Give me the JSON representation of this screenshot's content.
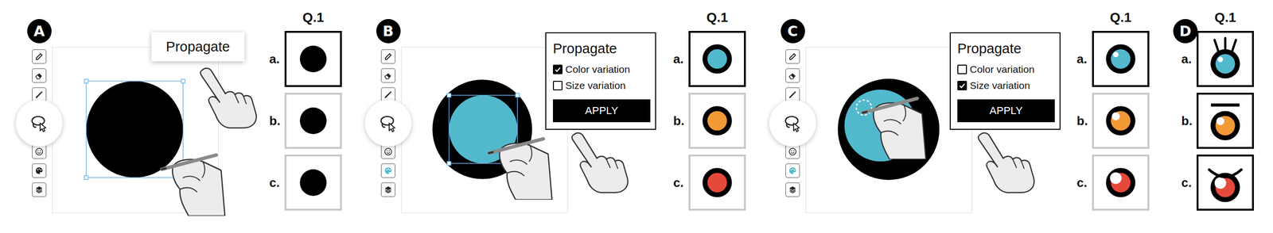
{
  "figure": {
    "panels": [
      {
        "badge": "A",
        "toolbar": [
          {
            "kind": "pencil",
            "selected": false
          },
          {
            "kind": "eraser",
            "selected": false
          },
          {
            "kind": "wand",
            "selected": false
          },
          {
            "kind": "smiley",
            "selected": false
          },
          {
            "kind": "palette",
            "selected": false
          },
          {
            "kind": "layers",
            "selected": false
          }
        ],
        "canvas": {
          "outer": "#000000",
          "inner": null,
          "selection": "outer",
          "draft": false
        },
        "menu": {
          "kind": "tooltip",
          "title": "Propagate",
          "options": [],
          "button": null
        },
        "question": {
          "title": "Q.1",
          "items": [
            {
              "label": "a.",
              "selected": true,
              "kind": "plain",
              "outer": "#000000",
              "pupil": null,
              "glint": "none"
            },
            {
              "label": "b.",
              "selected": false,
              "kind": "plain",
              "outer": "#000000",
              "pupil": null,
              "glint": "none"
            },
            {
              "label": "c.",
              "selected": false,
              "kind": "plain",
              "outer": "#000000",
              "pupil": null,
              "glint": "none"
            }
          ]
        }
      },
      {
        "badge": "B",
        "toolbar": [
          {
            "kind": "pencil",
            "selected": false
          },
          {
            "kind": "eraser",
            "selected": false
          },
          {
            "kind": "wand",
            "selected": false
          },
          {
            "kind": "smiley",
            "selected": false
          },
          {
            "kind": "palette",
            "selected": true
          },
          {
            "kind": "layers",
            "selected": false
          }
        ],
        "canvas": {
          "outer": "#000000",
          "inner": "#52b9cd",
          "selection": "inner",
          "draft": false
        },
        "menu": {
          "kind": "popup",
          "title": "Propagate",
          "options": [
            {
              "label": "Color variation",
              "checked": true
            },
            {
              "label": "Size variation",
              "checked": false
            }
          ],
          "button": "APPLY"
        },
        "question": {
          "title": "Q.1",
          "items": [
            {
              "label": "a.",
              "selected": true,
              "kind": "plain",
              "outer": "#000000",
              "pupil": "#52b9cd",
              "glint": "none"
            },
            {
              "label": "b.",
              "selected": false,
              "kind": "plain",
              "outer": "#000000",
              "pupil": "#f29a36",
              "glint": "none"
            },
            {
              "label": "c.",
              "selected": false,
              "kind": "plain",
              "outer": "#000000",
              "pupil": "#e5493a",
              "glint": "none"
            }
          ]
        }
      },
      {
        "badge": "C",
        "toolbar": [
          {
            "kind": "pencil",
            "selected": false
          },
          {
            "kind": "eraser",
            "selected": false
          },
          {
            "kind": "wand",
            "selected": false
          },
          {
            "kind": "smiley",
            "selected": false
          },
          {
            "kind": "palette",
            "selected": true
          },
          {
            "kind": "layers",
            "selected": false
          }
        ],
        "canvas": {
          "outer": "#000000",
          "inner": "#52b9cd",
          "selection": "none",
          "draft": true
        },
        "menu": {
          "kind": "popup",
          "title": "Propagate",
          "options": [
            {
              "label": "Color variation",
              "checked": false
            },
            {
              "label": "Size variation",
              "checked": true
            }
          ],
          "button": "APPLY"
        },
        "question": {
          "title": "Q.1",
          "items": [
            {
              "label": "a.",
              "selected": true,
              "kind": "plain",
              "outer": "#000000",
              "pupil": "#52b9cd",
              "glint": "small"
            },
            {
              "label": "b.",
              "selected": false,
              "kind": "plain",
              "outer": "#000000",
              "pupil": "#f29a36",
              "glint": "medium"
            },
            {
              "label": "c.",
              "selected": false,
              "kind": "plain",
              "outer": "#000000",
              "pupil": "#e5493a",
              "glint": "large"
            }
          ]
        }
      },
      {
        "badge": "D",
        "toolbar": null,
        "canvas": null,
        "menu": null,
        "question": {
          "title": "Q.1",
          "items": [
            {
              "label": "a.",
              "selected": true,
              "kind": "lashes",
              "outer": "#000000",
              "pupil": "#52b9cd",
              "glint": "small"
            },
            {
              "label": "b.",
              "selected": true,
              "kind": "lid",
              "outer": "#000000",
              "pupil": "#f29a36",
              "glint": "medium"
            },
            {
              "label": "c.",
              "selected": true,
              "kind": "brow",
              "outer": "#000000",
              "pupil": "#e5493a",
              "glint": "large"
            }
          ]
        }
      }
    ]
  }
}
